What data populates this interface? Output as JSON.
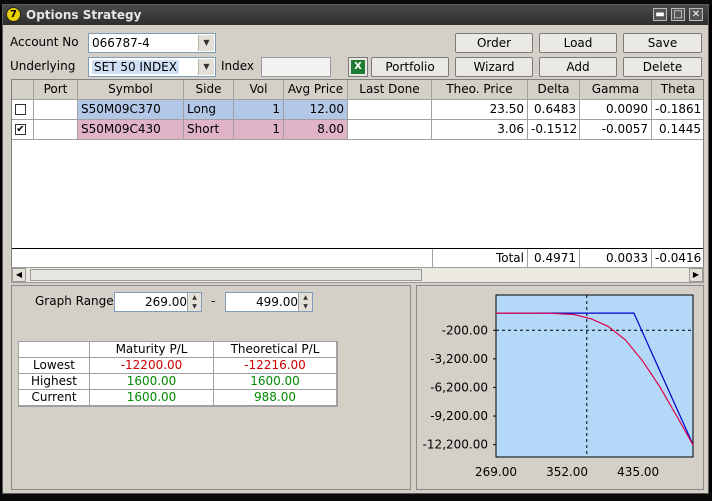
{
  "window": {
    "title": "Options Strategy"
  },
  "account": {
    "label": "Account No",
    "value": "066787-4"
  },
  "underlying": {
    "label": "Underlying",
    "value": "SET 50 INDEX"
  },
  "index": {
    "label": "Index",
    "value": ""
  },
  "buttons": {
    "order": "Order",
    "load": "Load",
    "save": "Save",
    "portfolio": "Portfolio",
    "wizard": "Wizard",
    "add": "Add",
    "delete": "Delete"
  },
  "grid": {
    "columns": [
      "Port",
      "Symbol",
      "Side",
      "Vol",
      "Avg Price",
      "Last Done",
      "Theo. Price",
      "Delta",
      "Gamma",
      "Theta"
    ],
    "rows": [
      {
        "checked": false,
        "port": "",
        "symbol": "S50M09C370",
        "side": "Long",
        "vol": "1",
        "avg_price": "12.00",
        "last_done": "",
        "theo_price": "23.50",
        "delta": "0.6483",
        "gamma": "0.0090",
        "theta": "-0.1861",
        "color": "#b3c7e6"
      },
      {
        "checked": true,
        "port": "",
        "symbol": "S50M09C430",
        "side": "Short",
        "vol": "1",
        "avg_price": "8.00",
        "last_done": "",
        "theo_price": "3.06",
        "delta": "-0.1512",
        "gamma": "-0.0057",
        "theta": "0.1445",
        "color": "#e0b3c8"
      }
    ],
    "total": {
      "label": "Total",
      "delta": "0.4971",
      "gamma": "0.0033",
      "theta": "-0.0416"
    }
  },
  "graph_range": {
    "label": "Graph Range",
    "from": "269.00",
    "separator": "-",
    "to": "499.00"
  },
  "pl_table": {
    "headers": [
      "",
      "Maturity P/L",
      "Theoretical P/L"
    ],
    "rows": [
      {
        "label": "Lowest",
        "maturity": "-12200.00",
        "theoretical": "-12216.00",
        "maturity_color": "red",
        "theoretical_color": "red"
      },
      {
        "label": "Highest",
        "maturity": "1600.00",
        "theoretical": "1600.00",
        "maturity_color": "green",
        "theoretical_color": "green"
      },
      {
        "label": "Current",
        "maturity": "1600.00",
        "theoretical": "988.00",
        "maturity_color": "green",
        "theoretical_color": "green"
      }
    ]
  },
  "chart_data": {
    "type": "line",
    "x_tick_labels": [
      "269.00",
      "352.00",
      "435.00"
    ],
    "y_tick_labels": [
      "-200.00",
      "-3,200.00",
      "-6,200.00",
      "-9,200.00",
      "-12,200.00"
    ],
    "xlim": [
      269,
      499
    ],
    "ylim": [
      -13500,
      3500
    ],
    "current_x": 375,
    "zero_line_y": -200,
    "background": "#b3d8f8",
    "series": [
      {
        "color": "#0000cc",
        "x": [
          269,
          370,
          430,
          499
        ],
        "y": [
          1600,
          1600,
          1600,
          -12200
        ]
      },
      {
        "color": "#e0004a",
        "x": [
          269,
          330,
          360,
          380,
          400,
          420,
          440,
          460,
          480,
          499
        ],
        "y": [
          1600,
          1590,
          1450,
          1000,
          200,
          -1200,
          -3400,
          -6100,
          -9200,
          -12216
        ]
      }
    ]
  }
}
